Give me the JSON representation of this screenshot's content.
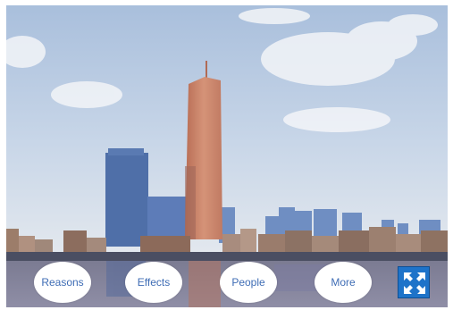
{
  "scene": {
    "image": "painting-city-skyline-river",
    "colors": {
      "sky_top": "#a9bfdc",
      "sky_bottom": "#dde6ef",
      "tower": "#c98466",
      "water": "#6d6e88"
    }
  },
  "buttons": {
    "reasons": "Reasons",
    "effects": "Effects",
    "people": "People",
    "more": "More"
  },
  "fullscreen": {
    "icon": "expand-arrows-icon",
    "color": "#1e73c9"
  }
}
